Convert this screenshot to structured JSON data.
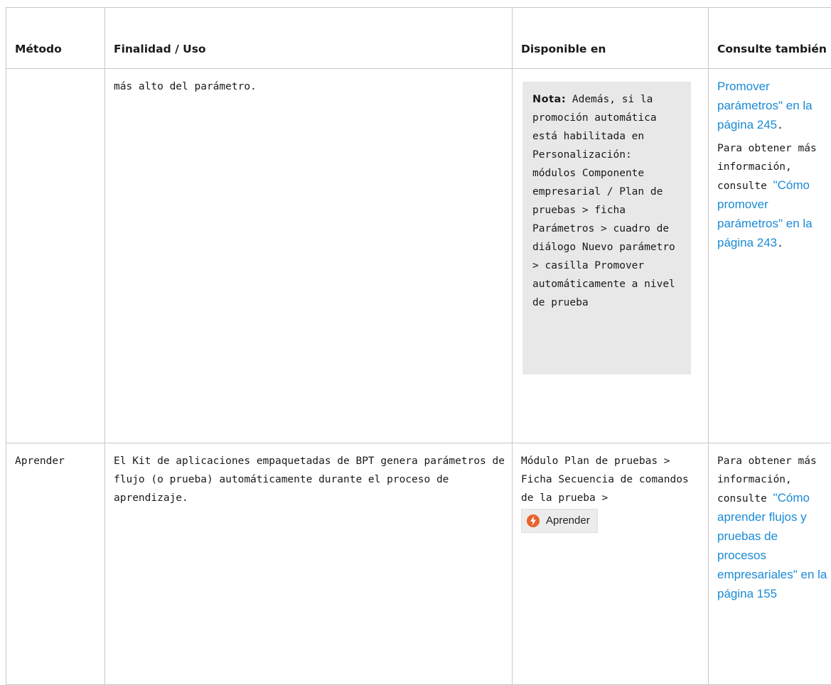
{
  "headers": {
    "metodo": "Método",
    "finalidad": "Finalidad / Uso",
    "disponible": "Disponible en",
    "consulte": "Consulte también"
  },
  "rows": [
    {
      "metodo": "",
      "finalidad": "más alto del parámetro.",
      "note": {
        "label": "Nota:",
        "text": "Además, si la promoción automática está habilitada en Personalización: módulos Componente empresarial / Plan de pruebas > ficha Parámetros > cuadro de diálogo Nuevo parámetro > casilla Promover automáticamente a nivel de prueba"
      },
      "consulte": {
        "link_top": "Promover parámetros\" en la página 245",
        "link_top_end": ".",
        "para_prefix": "Para obtener más información, consulte ",
        "link": "\"Cómo promover parámetros\" en la página 243",
        "link_end": "."
      }
    },
    {
      "metodo": "Aprender",
      "finalidad": "El Kit de aplicaciones empaquetadas de BPT genera parámetros de flujo (o prueba) automáticamente durante el proceso de aprendizaje.",
      "disponible": "Módulo Plan de pruebas > Ficha Secuencia de comandos de la prueba >",
      "button_label": "Aprender",
      "button_icon": "lightning-icon",
      "button_icon_color": "#e8632a",
      "consulte": {
        "para_prefix": "Para obtener más información, consulte ",
        "link": "\"Cómo aprender flujos y pruebas de procesos empresariales\" en la página 155"
      }
    }
  ],
  "colors": {
    "link": "#1a8ad6",
    "note_bg": "#e8e8e8",
    "border": "#c8c8c8"
  }
}
